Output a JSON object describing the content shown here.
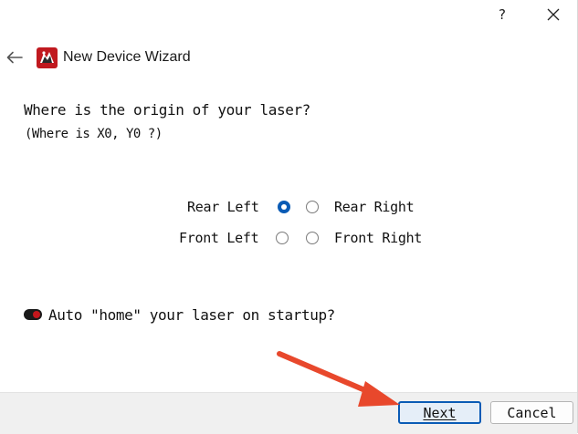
{
  "window": {
    "help_label": "?",
    "close_icon": "close-icon"
  },
  "header": {
    "back_icon": "arrow-left-icon",
    "logo_icon": "app-logo-icon",
    "title": "New Device Wizard"
  },
  "question": {
    "main": "Where is the origin of your laser?",
    "sub": "(Where is X0, Y0 ?)"
  },
  "origin_options": {
    "rear_left": {
      "label": "Rear Left",
      "selected": true
    },
    "rear_right": {
      "label": "Rear Right",
      "selected": false
    },
    "front_left": {
      "label": "Front Left",
      "selected": false
    },
    "front_right": {
      "label": "Front Right",
      "selected": false
    }
  },
  "auto_home": {
    "label": "Auto \"home\" your laser on startup?",
    "enabled": true
  },
  "buttons": {
    "next": "Next",
    "cancel": "Cancel"
  },
  "colors": {
    "accent": "#0a5bb5",
    "toggle_knob": "#c4161c",
    "annotation_arrow": "#e8482c",
    "footer_bg": "#f0f0f0"
  }
}
